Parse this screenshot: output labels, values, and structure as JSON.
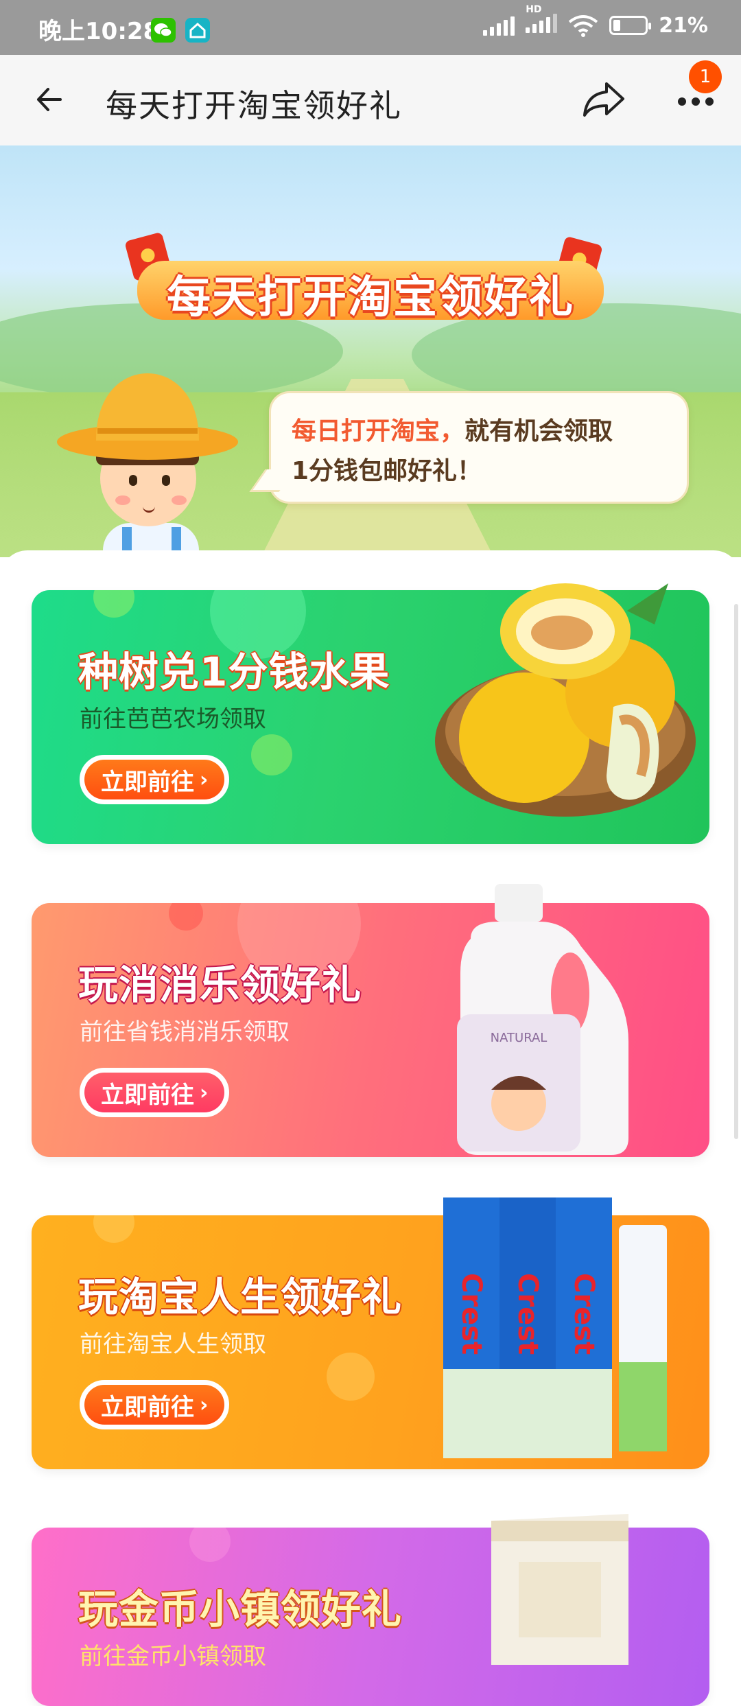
{
  "status_bar": {
    "time": "晚上10:28",
    "battery": "21%",
    "network_label": "HD"
  },
  "nav": {
    "title": "每天打开淘宝领好礼",
    "badge_count": "1"
  },
  "hero": {
    "title": "每天打开淘宝领好礼",
    "bubble_line1_highlight": "每日打开淘宝，",
    "bubble_line1_rest": "就有机会领取",
    "bubble_line2": "1分钱包邮好礼！"
  },
  "cards": [
    {
      "title": "种树兑1分钱水果",
      "subtitle": "前往芭芭农场领取",
      "button": "立即前往",
      "product_icon": "melon-basket"
    },
    {
      "title": "玩消消乐领好礼",
      "subtitle": "前往省钱消消乐领取",
      "button": "立即前往",
      "product_icon": "detergent-bottle",
      "product_text": "NATURAL"
    },
    {
      "title": "玩淘宝人生领好礼",
      "subtitle": "前往淘宝人生领取",
      "button": "立即前往",
      "product_icon": "toothpaste-boxes",
      "product_text": "Crest"
    },
    {
      "title": "玩金币小镇领好礼",
      "subtitle": "前往金币小镇领取",
      "product_icon": "rice-bag"
    }
  ],
  "colors": {
    "accent": "#ff5000",
    "card1": "#2bd26f",
    "card2": "#ff6f7c",
    "card3": "#ffa21e",
    "card4": "#d36ae8"
  }
}
